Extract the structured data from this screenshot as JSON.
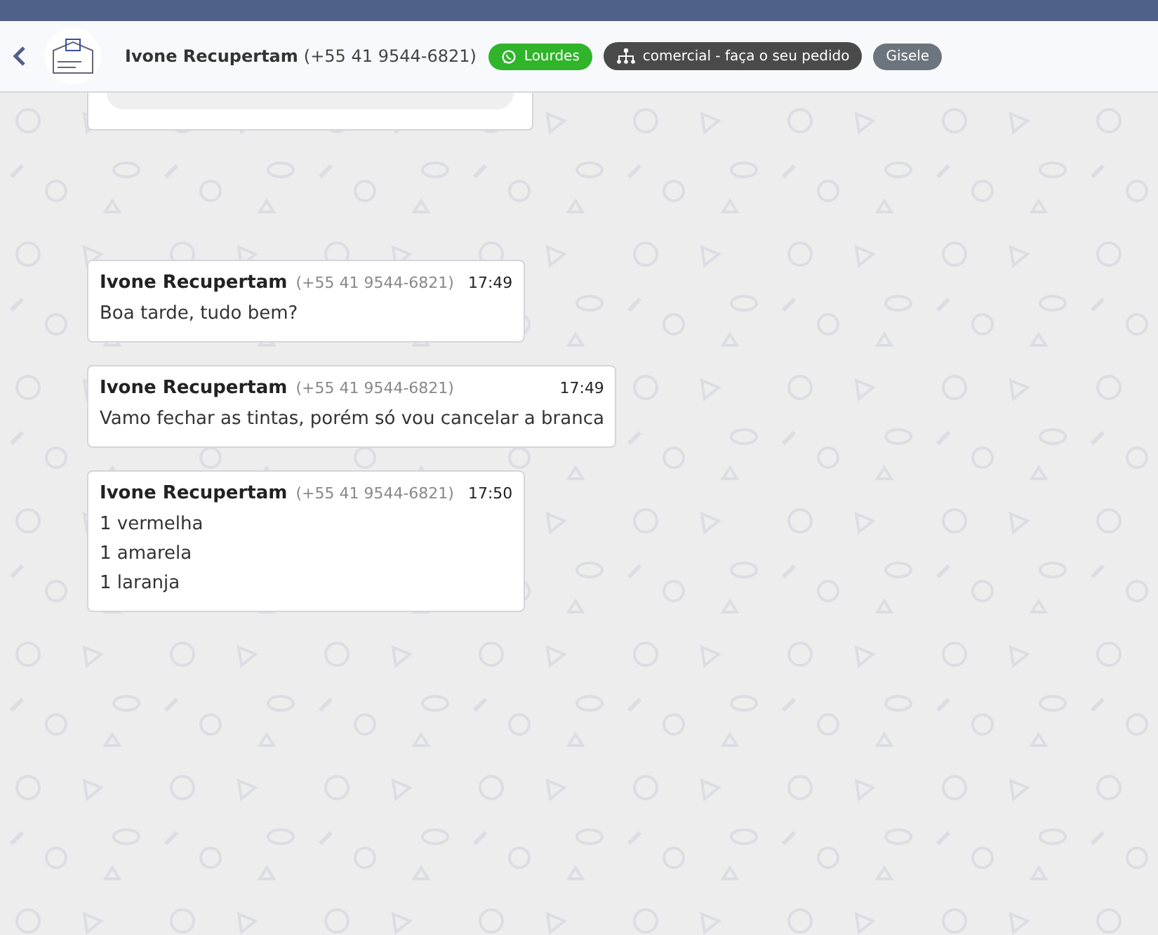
{
  "header": {
    "contact_name": "Ivone Recupertam",
    "contact_phone": "(+55 41 9544-6821)",
    "tags": [
      {
        "kind": "whatsapp",
        "label": "Lourdes",
        "color": "#2fb42a"
      },
      {
        "kind": "department",
        "label": "comercial - faça o seu pedido",
        "color": "#4a4a4a"
      },
      {
        "kind": "plain",
        "label": "Gisele",
        "color": "#6c757d"
      }
    ]
  },
  "messages": [
    {
      "sender": "Ivone Recupertam",
      "phone": "(+55 41 9544-6821)",
      "time": "17:49",
      "lines": [
        "Boa tarde, tudo bem?"
      ]
    },
    {
      "sender": "Ivone Recupertam",
      "phone": "(+55 41 9544-6821)",
      "time": "17:49",
      "lines": [
        "Vamo fechar as tintas, porém só vou cancelar a branca"
      ]
    },
    {
      "sender": "Ivone Recupertam",
      "phone": "(+55 41 9544-6821)",
      "time": "17:50",
      "lines": [
        "1 vermelha",
        "1 amarela",
        "1 laranja"
      ]
    }
  ]
}
